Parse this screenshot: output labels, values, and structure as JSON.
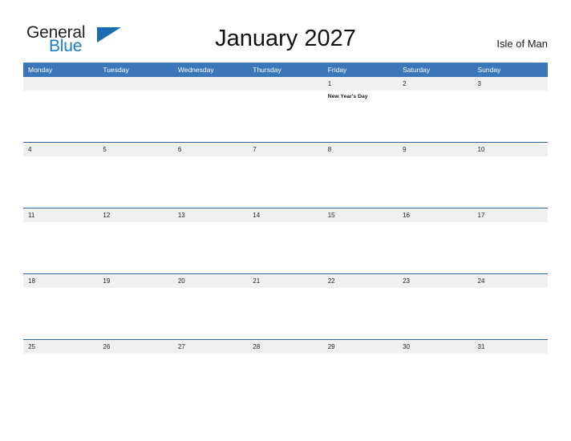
{
  "brand": {
    "name_part1": "General",
    "name_part2": "Blue",
    "logo_icon": "triangle-flag-icon",
    "accent_color": "#1b6cb3"
  },
  "header": {
    "title": "January 2027",
    "locale": "Isle of Man"
  },
  "theme": {
    "header_blue": "#3a76b8",
    "separator_blue": "#2e6da4",
    "date_band_gray": "#f0f0f0",
    "page_background": "#ffffff"
  },
  "calendar": {
    "month": "January",
    "year": "2027",
    "weekday_headers": [
      "Monday",
      "Tuesday",
      "Wednesday",
      "Thursday",
      "Friday",
      "Saturday",
      "Sunday"
    ],
    "weeks": [
      {
        "days": [
          {
            "number": "",
            "event": ""
          },
          {
            "number": "",
            "event": ""
          },
          {
            "number": "",
            "event": ""
          },
          {
            "number": "",
            "event": ""
          },
          {
            "number": "1",
            "event": "New Year's Day"
          },
          {
            "number": "2",
            "event": ""
          },
          {
            "number": "3",
            "event": ""
          }
        ]
      },
      {
        "days": [
          {
            "number": "4",
            "event": ""
          },
          {
            "number": "5",
            "event": ""
          },
          {
            "number": "6",
            "event": ""
          },
          {
            "number": "7",
            "event": ""
          },
          {
            "number": "8",
            "event": ""
          },
          {
            "number": "9",
            "event": ""
          },
          {
            "number": "10",
            "event": ""
          }
        ]
      },
      {
        "days": [
          {
            "number": "11",
            "event": ""
          },
          {
            "number": "12",
            "event": ""
          },
          {
            "number": "13",
            "event": ""
          },
          {
            "number": "14",
            "event": ""
          },
          {
            "number": "15",
            "event": ""
          },
          {
            "number": "16",
            "event": ""
          },
          {
            "number": "17",
            "event": ""
          }
        ]
      },
      {
        "days": [
          {
            "number": "18",
            "event": ""
          },
          {
            "number": "19",
            "event": ""
          },
          {
            "number": "20",
            "event": ""
          },
          {
            "number": "21",
            "event": ""
          },
          {
            "number": "22",
            "event": ""
          },
          {
            "number": "23",
            "event": ""
          },
          {
            "number": "24",
            "event": ""
          }
        ]
      },
      {
        "days": [
          {
            "number": "25",
            "event": ""
          },
          {
            "number": "26",
            "event": ""
          },
          {
            "number": "27",
            "event": ""
          },
          {
            "number": "28",
            "event": ""
          },
          {
            "number": "29",
            "event": ""
          },
          {
            "number": "30",
            "event": ""
          },
          {
            "number": "31",
            "event": ""
          }
        ]
      }
    ]
  }
}
